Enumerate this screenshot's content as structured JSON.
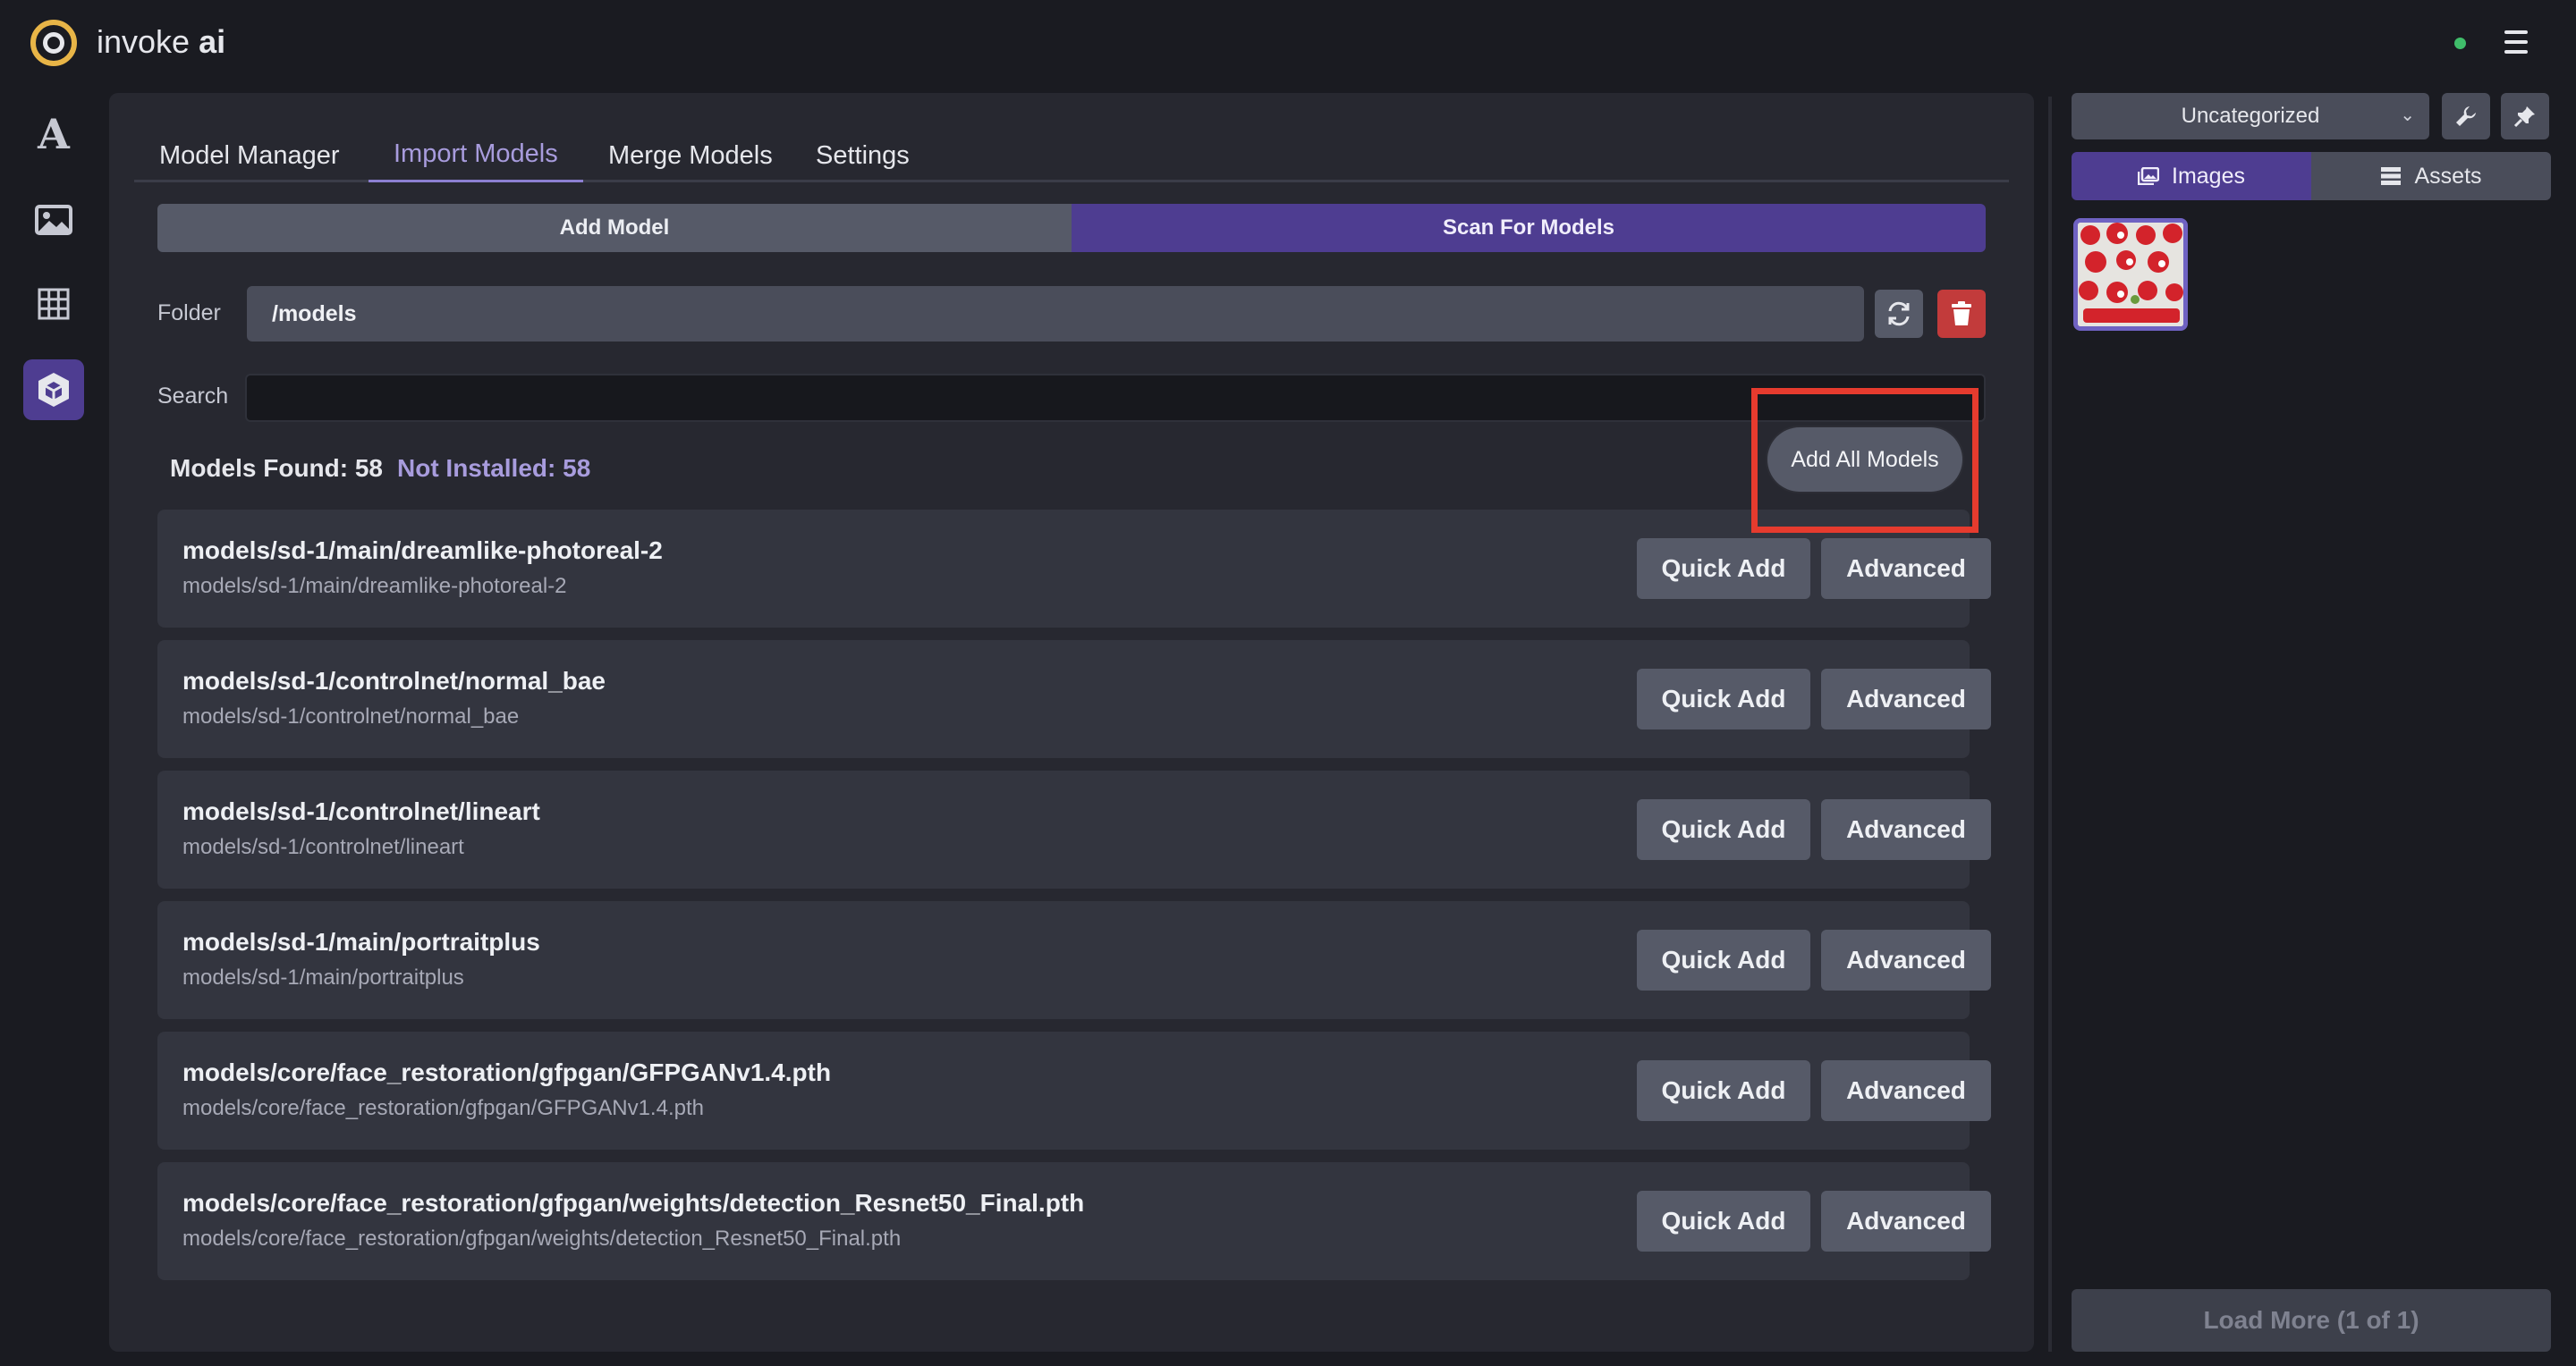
{
  "app": {
    "brand_name": "invoke",
    "brand_suffix": "ai"
  },
  "rail": {
    "items": [
      {
        "name": "text-to-image",
        "icon": "letter-a-icon"
      },
      {
        "name": "image-to-image",
        "icon": "image-icon"
      },
      {
        "name": "unified-canvas",
        "icon": "grid-icon"
      },
      {
        "name": "model-manager",
        "icon": "cube-icon",
        "active": true
      }
    ]
  },
  "tabs": {
    "items": [
      "Model Manager",
      "Import Models",
      "Merge Models",
      "Settings"
    ],
    "active_index": 1
  },
  "import_mode": {
    "add_label": "Add Model",
    "scan_label": "Scan For Models",
    "active": "scan"
  },
  "folder": {
    "label": "Folder",
    "value": "/models"
  },
  "search": {
    "label": "Search",
    "value": ""
  },
  "results": {
    "found_label": "Models Found: 58",
    "not_installed_label": "Not Installed: 58",
    "add_all_label": "Add All Models",
    "quick_add_label": "Quick Add",
    "advanced_label": "Advanced",
    "models": [
      {
        "title": "models/sd-1/main/dreamlike-photoreal-2",
        "path": "models/sd-1/main/dreamlike-photoreal-2"
      },
      {
        "title": "models/sd-1/controlnet/normal_bae",
        "path": "models/sd-1/controlnet/normal_bae"
      },
      {
        "title": "models/sd-1/controlnet/lineart",
        "path": "models/sd-1/controlnet/lineart"
      },
      {
        "title": "models/sd-1/main/portraitplus",
        "path": "models/sd-1/main/portraitplus"
      },
      {
        "title": "models/core/face_restoration/gfpgan/GFPGANv1.4.pth",
        "path": "models/core/face_restoration/gfpgan/GFPGANv1.4.pth"
      },
      {
        "title": "models/core/face_restoration/gfpgan/weights/detection_Resnet50_Final.pth",
        "path": "models/core/face_restoration/gfpgan/weights/detection_Resnet50_Final.pth"
      }
    ]
  },
  "gallery": {
    "board": "Uncategorized",
    "images_tab": "Images",
    "assets_tab": "Assets",
    "load_more": "Load More (1 of 1)"
  },
  "colors": {
    "accent": "#4e3d91",
    "highlight_box": "#e63b2e",
    "status_online": "#3fbd6a",
    "delete": "#c23b3b"
  }
}
